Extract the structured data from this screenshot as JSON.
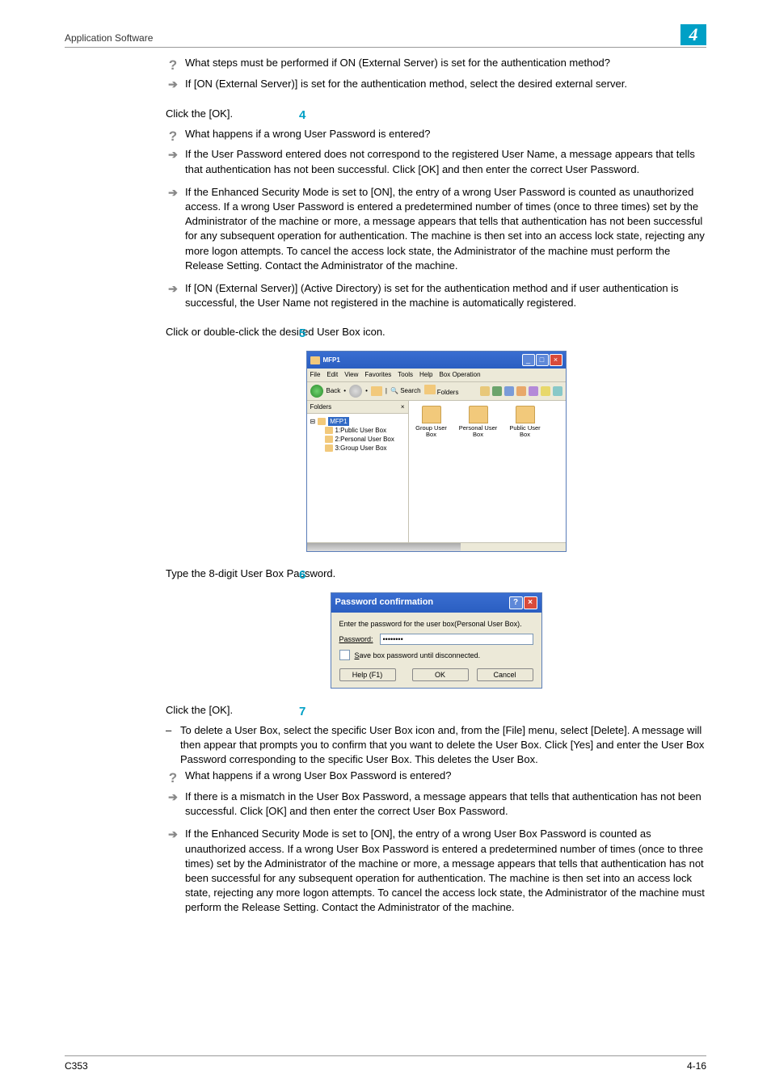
{
  "header": {
    "title": "Application Software",
    "chapter_number": "4"
  },
  "pre_step": {
    "q": "What steps must be performed if ON (External Server) is set for the authentication method?",
    "a": "If [ON (External Server)] is set for the authentication method, select the desired external server."
  },
  "step4": {
    "num": "4",
    "text": "Click the [OK].",
    "q": "What happens if a wrong User Password is entered?",
    "a1": "If the User Password entered does not correspond to the registered User Name, a message appears that tells that authentication has not been successful. Click [OK] and then enter the correct User Password.",
    "a2": "If the Enhanced Security Mode is set to [ON], the entry of a wrong User Password is counted as unauthorized access. If a wrong User Password is entered a predetermined number of times (once to three times) set by the Administrator of the machine or more, a message appears that tells that authentication has not been successful for any subsequent operation for authentication. The machine is then set into an access lock state, rejecting any more logon attempts. To cancel the access lock state, the Administrator of the machine must perform the Release Setting. Contact the Administrator of the machine.",
    "a3": "If [ON (External Server)] (Active Directory) is set for the authentication method and if user authentication is successful, the User Name not registered in the machine is automatically registered."
  },
  "step5": {
    "num": "5",
    "text": "Click or double-click the desired User Box icon."
  },
  "explorer": {
    "title": "MFP1",
    "menus": [
      "File",
      "Edit",
      "View",
      "Favorites",
      "Tools",
      "Help",
      "Box Operation"
    ],
    "back": "Back",
    "search": "Search",
    "folders_btn": "Folders",
    "folders_label": "Folders",
    "close": "×",
    "tree_root": "MFP1",
    "tree_items": [
      "1:Public User Box",
      "2:Personal User Box",
      "3:Group User Box"
    ],
    "items": [
      {
        "label": "Group User Box"
      },
      {
        "label": "Personal User Box"
      },
      {
        "label": "Public User Box"
      }
    ]
  },
  "step6": {
    "num": "6",
    "text": "Type the 8-digit User Box Password."
  },
  "dialog": {
    "title": "Password confirmation",
    "prompt": "Enter the password for the user box(Personal User Box).",
    "password_label": "Password:",
    "password_value": "••••••••",
    "save_label": "Save box password until disconnected.",
    "help": "Help (F1)",
    "ok": "OK",
    "cancel": "Cancel"
  },
  "step7": {
    "num": "7",
    "text": "Click the [OK].",
    "dash": "To delete a User Box, select the specific User Box icon and, from the [File] menu, select [Delete]. A message will then appear that prompts you to confirm that you want to delete the User Box. Click [Yes] and enter the User Box Password corresponding to the specific User Box. This deletes the User Box.",
    "q": "What happens if a wrong User Box Password is entered?",
    "a1": "If there is a mismatch in the User Box Password, a message appears that tells that authentication has not been successful. Click [OK] and then enter the correct User Box Password.",
    "a2": "If the Enhanced Security Mode is set to [ON], the entry of a wrong User Box Password is counted as unauthorized access. If a wrong User Box Password is entered a predetermined number of times (once to three times) set by the Administrator of the machine or more, a message appears that tells that authentication has not been successful for any subsequent operation for authentication. The machine is then set into an access lock state, rejecting any more logon attempts. To cancel the access lock state, the Administrator of the machine must perform the Release Setting. Contact the Administrator of the machine."
  },
  "footer": {
    "left": "C353",
    "right": "4-16"
  }
}
